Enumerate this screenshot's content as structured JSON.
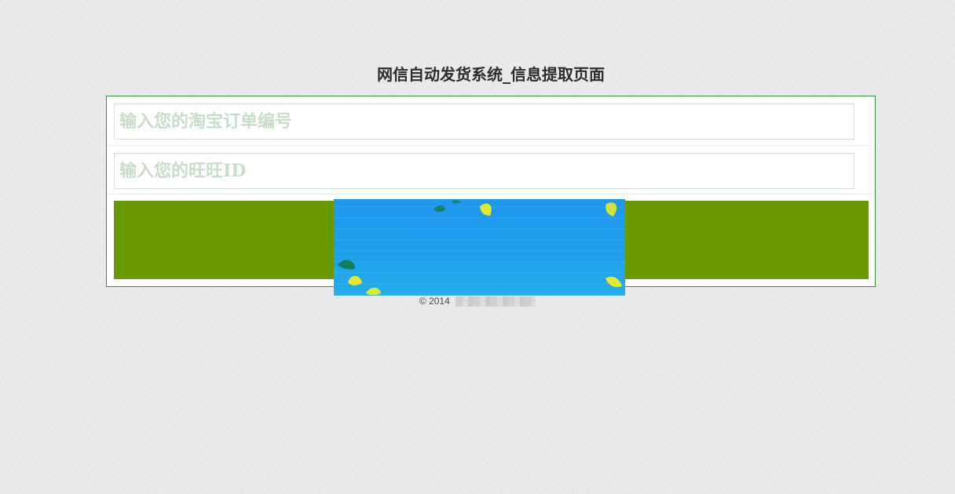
{
  "page": {
    "title": "网信自动发货系统_信息提取页面"
  },
  "form": {
    "order_placeholder": "输入您的淘宝订单编号",
    "wangwang_placeholder": "输入您的旺旺ID",
    "submit_label": ""
  },
  "footer": {
    "copyright": "© 2014"
  },
  "colors": {
    "background": "#e9e9e9",
    "panel_border": "#2f8f3b",
    "submit_button": "#6a9a00",
    "placeholder_text": "#c7ddc7"
  },
  "icons": {
    "overlay_image": "blue-leaves-image"
  }
}
